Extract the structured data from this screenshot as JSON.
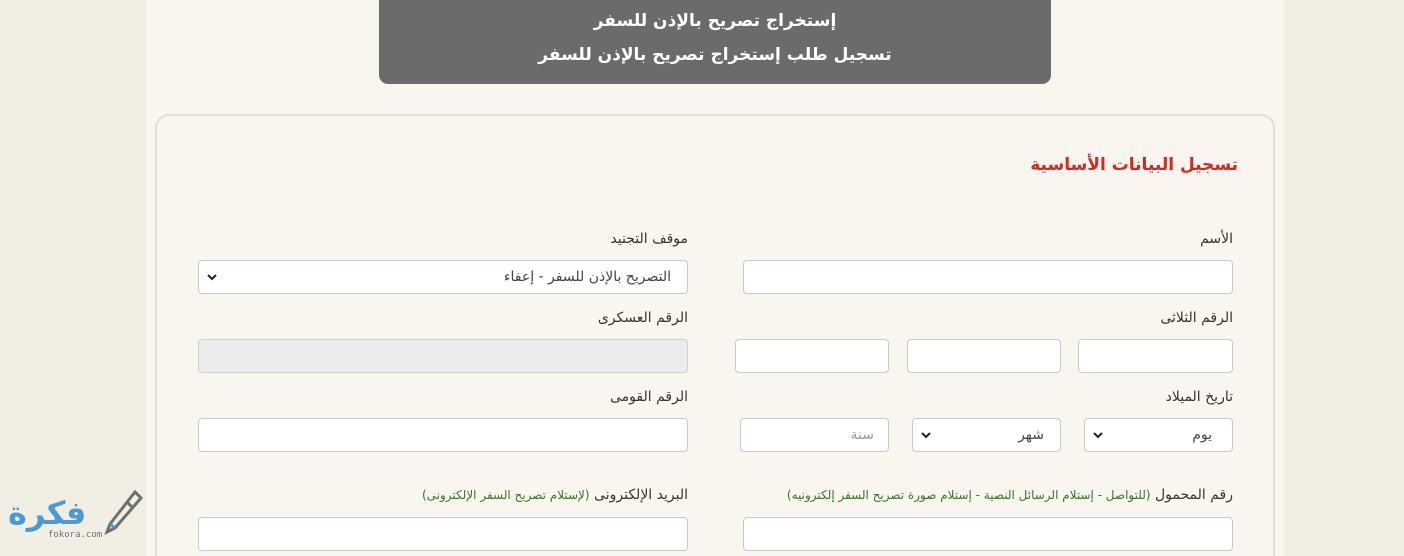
{
  "banner": {
    "line1": "إستخراج تصريح بالإذن للسفر",
    "line2": "تسجيل طلب إستخراج تصريح بالإذن للسفر"
  },
  "form": {
    "section_title": "تسجيل البيانات الأساسية",
    "name_label": "الأسم",
    "name_value": "",
    "conscription_label": "موقف التجنيد",
    "conscription_selected": "التصريح بالإذن للسفر - إعفاء",
    "triple_number_label": "الرقم الثلاثى",
    "military_number_label": "الرقم العسكرى",
    "birthdate_label": "تاريخ الميلاد",
    "day_selected": "يوم",
    "month_selected": "شهر",
    "year_placeholder": "سنة",
    "national_id_label": "الرقم القومى",
    "mobile_label": "رقم المحمول",
    "mobile_hint": "(للتواصل - إستلام الرسائل النصية - إستلام صورة تصريح السفر إلكترونيه)",
    "email_label": "البريد الإلكترونى",
    "email_hint": "(لإستلام تصريح السفر الإلكترونى)"
  },
  "logo": {
    "text": "فكرة",
    "sub": "fokora.com"
  },
  "colors": {
    "section_title": "#e0231b",
    "hint": "#2e7d1f",
    "banner_bg": "#6b6b6b",
    "logo": "#4a9ad4"
  }
}
